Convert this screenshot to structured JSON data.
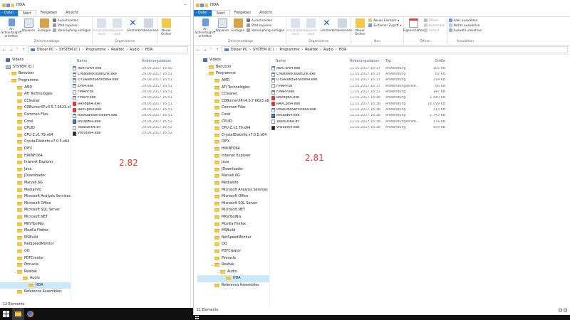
{
  "left": {
    "title": "HDA",
    "tabs": [
      "Datei",
      "Start",
      "Freigeben",
      "Ansicht"
    ],
    "ribbon": {
      "pin_label": "An Schnellzugriff anheften",
      "copy_label": "Kopieren",
      "paste_label": "Einfügen",
      "cut_label": "Ausschneiden",
      "copy_path_label": "Pfad kopieren",
      "paste_link_label": "Verknüpfung einfügen",
      "move_label": "Verschieben nach",
      "copy_to_label": "Kopieren nach",
      "delete_label": "Löschen",
      "rename_label": "Umbenennen",
      "new_folder_label": "Neuer Ordner",
      "group_clipboard": "Zwischenablage",
      "group_organize": "Organisieren"
    },
    "address": [
      "Dieser PC",
      "SYSTEM (C:)",
      "Programme",
      "Realtek",
      "Audio",
      "HDA"
    ],
    "tree": [
      {
        "label": "Videos",
        "icon": "video-folder-icon",
        "level": 0
      },
      {
        "label": "SYSTEM (C:)",
        "icon": "drive-icon",
        "level": 0,
        "expanded": true
      },
      {
        "label": "Benutzer",
        "level": 1
      },
      {
        "label": "Programme",
        "level": 1,
        "expanded": true
      },
      {
        "label": "AMD",
        "level": 2
      },
      {
        "label": "ATI Technologies",
        "level": 2
      },
      {
        "label": "CCleaner",
        "level": 2
      },
      {
        "label": "CDBurnerXP.v4.5.7.6623.x64",
        "level": 2
      },
      {
        "label": "Common Files",
        "level": 2
      },
      {
        "label": "Corel",
        "level": 2
      },
      {
        "label": "CPUID",
        "level": 2
      },
      {
        "label": "CPU-Z.v1.79.x64",
        "level": 2
      },
      {
        "label": "CrystalDiskInfo.v7.0.5.x64",
        "level": 2
      },
      {
        "label": "DIFX",
        "level": 2
      },
      {
        "label": "HWiNFO64",
        "level": 2
      },
      {
        "label": "Internet Explorer",
        "level": 2
      },
      {
        "label": "Java",
        "level": 2
      },
      {
        "label": "JDownloader",
        "level": 2
      },
      {
        "label": "Marvell.6G",
        "level": 2
      },
      {
        "label": "MediaInfo",
        "level": 2
      },
      {
        "label": "Microsoft Analysis Services",
        "level": 2
      },
      {
        "label": "Microsoft Office",
        "level": 2
      },
      {
        "label": "Microsoft SQL Server",
        "level": 2
      },
      {
        "label": "Microsoft.NET",
        "level": 2
      },
      {
        "label": "MKVToolNix",
        "level": 2
      },
      {
        "label": "Mozilla Firefox",
        "level": 2
      },
      {
        "label": "MSBuild",
        "level": 2
      },
      {
        "label": "NetSpeedMonitor",
        "level": 2
      },
      {
        "label": "OO",
        "level": 2
      },
      {
        "label": "PDFCreator",
        "level": 2
      },
      {
        "label": "Pinnacle",
        "level": 2
      },
      {
        "label": "Realtek",
        "level": 2,
        "expanded": true
      },
      {
        "label": "Audio",
        "level": 3,
        "expanded": true
      },
      {
        "label": "HDA",
        "level": 4,
        "selected": true
      },
      {
        "label": "Reference Assemblies",
        "level": 2
      }
    ],
    "columns": {
      "name": "Name",
      "date": "Änderungsdatum"
    },
    "files": [
      {
        "name": "AERTSr64.exe",
        "date": "29.06.2017 16:50",
        "icon": "exe-icon"
      },
      {
        "name": "CreateRtkToastLnk.exe",
        "date": "29.06.2017 16:51",
        "icon": "exe-icon"
      },
      {
        "name": "DTSAudioService64.exe",
        "date": "29.06.2017 16:51",
        "icon": "exe-icon"
      },
      {
        "name": "EP64.exe",
        "date": "29.06.2017 16:51",
        "icon": "exe-icon"
      },
      {
        "name": "FMAPP.dll",
        "date": "29.06.2017 16:51",
        "icon": "dll-icon"
      },
      {
        "name": "FMAPP.exe",
        "date": "29.06.2017 16:51",
        "icon": "exe-icon"
      },
      {
        "name": "RAVBg64.exe",
        "date": "29.06.2017 16:51",
        "icon": "speaker-icon"
      },
      {
        "name": "RAVCpl64.exe",
        "date": "29.06.2017 16:51",
        "icon": "speaker-icon"
      },
      {
        "name": "RtkAudioService64.exe",
        "date": "29.06.2017 16:51",
        "icon": "exe-icon"
      },
      {
        "name": "RtlUpd64.exe",
        "date": "29.06.2017 16:52",
        "icon": "installer-icon"
      },
      {
        "name": "ToastDll64.dll",
        "date": "29.06.2017 16:52",
        "icon": "dll-icon"
      },
      {
        "name": "vncutil64.exe",
        "date": "29.06.2017 16:52",
        "icon": "console-icon"
      }
    ],
    "version": "2.82",
    "status": "12 Elemente"
  },
  "right": {
    "title": "HDA",
    "tabs": [
      "Datei",
      "Start",
      "Freigeben",
      "Ansicht"
    ],
    "ribbon": {
      "pin_label": "An Schnellzugriff anheften",
      "copy_label": "Kopieren",
      "paste_label": "Einfügen",
      "cut_label": "Ausschneiden",
      "copy_path_label": "Pfad kopieren",
      "paste_link_label": "Verknüpfung einfügen",
      "move_label": "Verschieben nach",
      "copy_to_label": "Kopieren nach",
      "delete_label": "Löschen",
      "rename_label": "Umbenennen",
      "new_folder_label": "Neuer Ordner",
      "new_element_label": "Neues Element",
      "easy_access_label": "Einfacher Zugriff",
      "properties_label": "Eigenschaften",
      "open_label": "Öffnen",
      "edit_label": "Bearbeiten",
      "history_label": "Verlauf",
      "select_all_label": "Alles auswählen",
      "select_none_label": "Nichts auswählen",
      "invert_label": "Auswahl umkehren",
      "group_clipboard": "Zwischenablage",
      "group_organize": "Organisieren",
      "group_new": "Neu",
      "group_open": "Öffnen",
      "group_select": "Auswählen"
    },
    "address": [
      "Dieser PC",
      "SYSTEM (C:)",
      "Programme",
      "Realtek",
      "Audio",
      "HDA"
    ],
    "tree": [
      {
        "label": "Videos",
        "icon": "video-folder-icon",
        "level": 0
      },
      {
        "label": "Benutzer",
        "level": 1
      },
      {
        "label": "Programme",
        "level": 1,
        "expanded": true
      },
      {
        "label": "AMD",
        "level": 2
      },
      {
        "label": "ATI Technologies",
        "level": 2
      },
      {
        "label": "CCleaner",
        "level": 2
      },
      {
        "label": "CDBurnerXP.v4.5.7.6623.x64",
        "level": 2
      },
      {
        "label": "Common Files",
        "level": 2
      },
      {
        "label": "Corel",
        "level": 2
      },
      {
        "label": "CPUID",
        "level": 2
      },
      {
        "label": "CPU-Z.v1.79.x64",
        "level": 2
      },
      {
        "label": "CrystalDiskInfo.v7.0.5.x64",
        "level": 2
      },
      {
        "label": "DIFX",
        "level": 2
      },
      {
        "label": "HWiNFO64",
        "level": 2
      },
      {
        "label": "Internet Explorer",
        "level": 2
      },
      {
        "label": "Java",
        "level": 2
      },
      {
        "label": "JDownloader",
        "level": 2
      },
      {
        "label": "Marvell.6G",
        "level": 2
      },
      {
        "label": "MediaInfo",
        "level": 2
      },
      {
        "label": "Microsoft Analysis Services",
        "level": 2
      },
      {
        "label": "Microsoft Office",
        "level": 2
      },
      {
        "label": "Microsoft SQL Server",
        "level": 2
      },
      {
        "label": "Microsoft.NET",
        "level": 2
      },
      {
        "label": "MKVToolNix",
        "level": 2
      },
      {
        "label": "Mozilla Firefox",
        "level": 2
      },
      {
        "label": "MSBuild",
        "level": 2
      },
      {
        "label": "NetSpeedMonitor",
        "level": 2
      },
      {
        "label": "OO",
        "level": 2
      },
      {
        "label": "PDFCreator",
        "level": 2
      },
      {
        "label": "Pinnacle",
        "level": 2
      },
      {
        "label": "Realtek",
        "level": 2,
        "expanded": true
      },
      {
        "label": "Audio",
        "level": 3,
        "expanded": true
      },
      {
        "label": "HDA",
        "level": 4,
        "selected": true
      },
      {
        "label": "Reference Assemblies",
        "level": 2
      }
    ],
    "columns": {
      "name": "Name",
      "date": "Änderungsdatum",
      "type": "Typ",
      "size": "Größe"
    },
    "files": [
      {
        "name": "AERTSr64.exe",
        "date": "11.01.2017 16:37",
        "type": "Anwendung",
        "size": "105 KB",
        "icon": "exe-icon"
      },
      {
        "name": "CreateRtkToastLnk.exe",
        "date": "11.01.2017 16:37",
        "type": "Anwendung",
        "size": "82 KB",
        "icon": "exe-icon"
      },
      {
        "name": "DTSAudioService64.exe",
        "date": "11.01.2017 16:37",
        "type": "Anwendung",
        "size": "214 KB",
        "icon": "exe-icon"
      },
      {
        "name": "FMAPP.dll",
        "date": "11.01.2017 16:37",
        "type": "Anwendungserwe...",
        "size": "86 KB",
        "icon": "dll-icon"
      },
      {
        "name": "FMAPP.exe",
        "date": "11.01.2017 16:37",
        "type": "Anwendung",
        "size": "147 KB",
        "icon": "exe-icon"
      },
      {
        "name": "RAVBg64.exe",
        "date": "11.01.2017 16:38",
        "type": "Anwendung",
        "size": "1.440 KB",
        "icon": "speaker-icon"
      },
      {
        "name": "RAVCpl64.exe",
        "date": "11.01.2017 16:38",
        "type": "Anwendung",
        "size": "16.099 KB",
        "icon": "speaker-icon"
      },
      {
        "name": "RtkAudioService64.exe",
        "date": "11.01.2017 16:38",
        "type": "Anwendung",
        "size": "313 KB",
        "icon": "exe-icon"
      },
      {
        "name": "RtlUpd64.exe",
        "date": "11.01.2017 16:38",
        "type": "Anwendung",
        "size": "1.743 KB",
        "icon": "installer-icon"
      },
      {
        "name": "ToastDll64.dll",
        "date": "11.01.2017 16:38",
        "type": "Anwendungserwe...",
        "size": "174 KB",
        "icon": "dll-icon"
      },
      {
        "name": "vncutil64.exe",
        "date": "11.01.2017 16:38",
        "type": "Anwendung",
        "size": "559 KB",
        "icon": "console-icon"
      }
    ],
    "version": "2.81",
    "status": "11 Elemente"
  },
  "colors": {
    "accent": "#1979ca",
    "version_text": "#e53935",
    "selection": "#cce8ff",
    "folder": "#f2c94c",
    "taskbar": "#101010"
  }
}
